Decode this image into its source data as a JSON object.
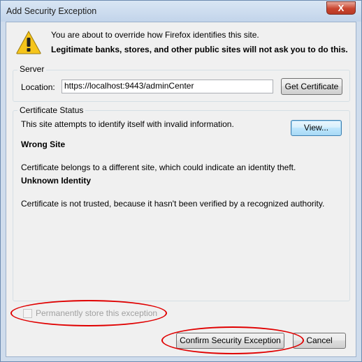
{
  "window": {
    "title": "Add Security Exception",
    "close_label": "X"
  },
  "header": {
    "icon": "warning-icon",
    "message": "You are about to override how Firefox identifies this site.",
    "bold_message": "Legitimate banks, stores, and other public sites will not ask you to do this."
  },
  "server": {
    "legend": "Server",
    "location_label": "Location:",
    "location_value": "https://localhost:9443/adminCenter",
    "get_certificate_label": "Get Certificate"
  },
  "status": {
    "legend": "Certificate Status",
    "intro": "This site attempts to identify itself with invalid information.",
    "view_label": "View...",
    "wrong_site_title": "Wrong Site",
    "wrong_site_text": "Certificate belongs to a different site, which could indicate an identity theft.",
    "unknown_identity_title": "Unknown Identity",
    "unknown_identity_text": "Certificate is not trusted, because it hasn't been verified by a recognized authority."
  },
  "footer": {
    "permanent_label": "Permanently store this exception",
    "confirm_label": "Confirm Security Exception",
    "cancel_label": "Cancel"
  },
  "colors": {
    "highlight": "#e00000",
    "title_bar": "#c2d4ea",
    "close_button": "#c9452f"
  }
}
